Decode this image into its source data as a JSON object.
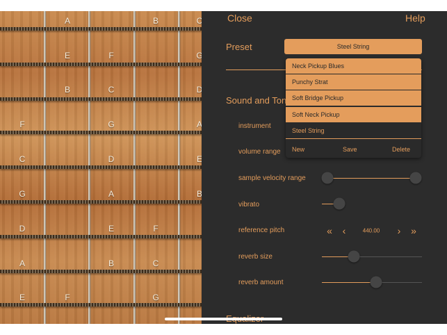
{
  "fretboard": {
    "notes": [
      {
        "label": "A"
      },
      {
        "label": "B"
      },
      {
        "label": "C"
      },
      {
        "label": "E"
      },
      {
        "label": "F"
      },
      {
        "label": "G"
      },
      {
        "label": "B"
      },
      {
        "label": "C"
      },
      {
        "label": "D"
      },
      {
        "label": "F"
      },
      {
        "label": "G"
      },
      {
        "label": "A"
      },
      {
        "label": "C"
      },
      {
        "label": "D"
      },
      {
        "label": "E"
      },
      {
        "label": "G"
      },
      {
        "label": "A"
      },
      {
        "label": "B"
      },
      {
        "label": "D"
      },
      {
        "label": "E"
      },
      {
        "label": "F"
      },
      {
        "label": "A"
      },
      {
        "label": "B"
      },
      {
        "label": "C"
      },
      {
        "label": "E"
      },
      {
        "label": "F"
      },
      {
        "label": "G"
      }
    ]
  },
  "header": {
    "close_label": "Close",
    "help_label": "Help"
  },
  "preset": {
    "label": "Preset",
    "selected": "Steel String",
    "options": [
      "Neck Pickup Blues",
      "Punchy Strat",
      "Soft Bridge Pickup",
      "Soft Neck Pickup",
      "Steel String"
    ],
    "actions": {
      "new": "New",
      "save": "Save",
      "delete": "Delete"
    }
  },
  "sound": {
    "title": "Sound and Tone",
    "instrument_label": "instrument",
    "volume_range_label": "volume range",
    "velocity_label": "sample velocity range",
    "velocity_range": [
      0.0,
      1.0
    ],
    "vibrato_label": "vibrato",
    "vibrato_value": 0.17,
    "pitch_label": "reference pitch",
    "pitch_value": "440.00",
    "reverb_size_label": "reverb size",
    "reverb_size_value": 0.3,
    "reverb_amount_label": "reverb amount",
    "reverb_amount_value": 0.55
  },
  "equalizer": {
    "title": "Equalizer"
  },
  "colors": {
    "accent": "#e49d5c",
    "panel": "#2c2c2c"
  }
}
